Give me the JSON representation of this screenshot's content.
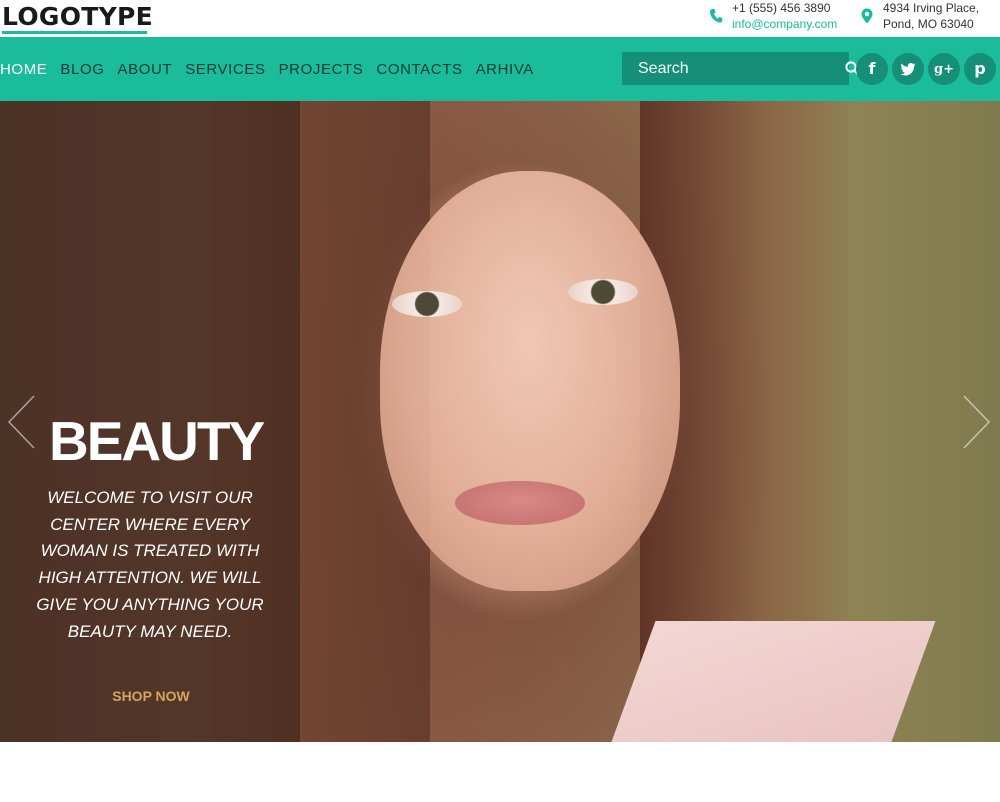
{
  "logo": {
    "text": "LOGOTYPE"
  },
  "contact": {
    "phone": "+1 (555) 456 3890",
    "email": "info@company.com",
    "address_line1": "4934 Irving Place,",
    "address_line2": "Pond, MO 63040"
  },
  "nav": {
    "items": [
      {
        "label": "HOME"
      },
      {
        "label": "BLOG"
      },
      {
        "label": "ABOUT"
      },
      {
        "label": "SERVICES"
      },
      {
        "label": "PROJECTS"
      },
      {
        "label": "CONTACTS"
      },
      {
        "label": "ARHIVA"
      }
    ],
    "active_index": 0
  },
  "search": {
    "placeholder": "Search",
    "icon": "search-icon"
  },
  "social": [
    {
      "icon": "facebook-icon",
      "glyph": "f"
    },
    {
      "icon": "twitter-icon",
      "glyph": "t"
    },
    {
      "icon": "google-plus-icon",
      "glyph": "g+"
    },
    {
      "icon": "pinterest-icon",
      "glyph": "p"
    }
  ],
  "hero": {
    "title": "BEAUTY",
    "text": "WELCOME TO VISIT OUR CENTER WHERE EVERY WOMAN IS TREATED WITH HIGH ATTENTION. WE WILL GIVE YOU ANYTHING YOUR BEAUTY MAY NEED.",
    "cta": "SHOP NOW"
  },
  "colors": {
    "accent": "#1bbc9b",
    "accent_dark": "#158f78",
    "cta": "#d4a45f"
  }
}
